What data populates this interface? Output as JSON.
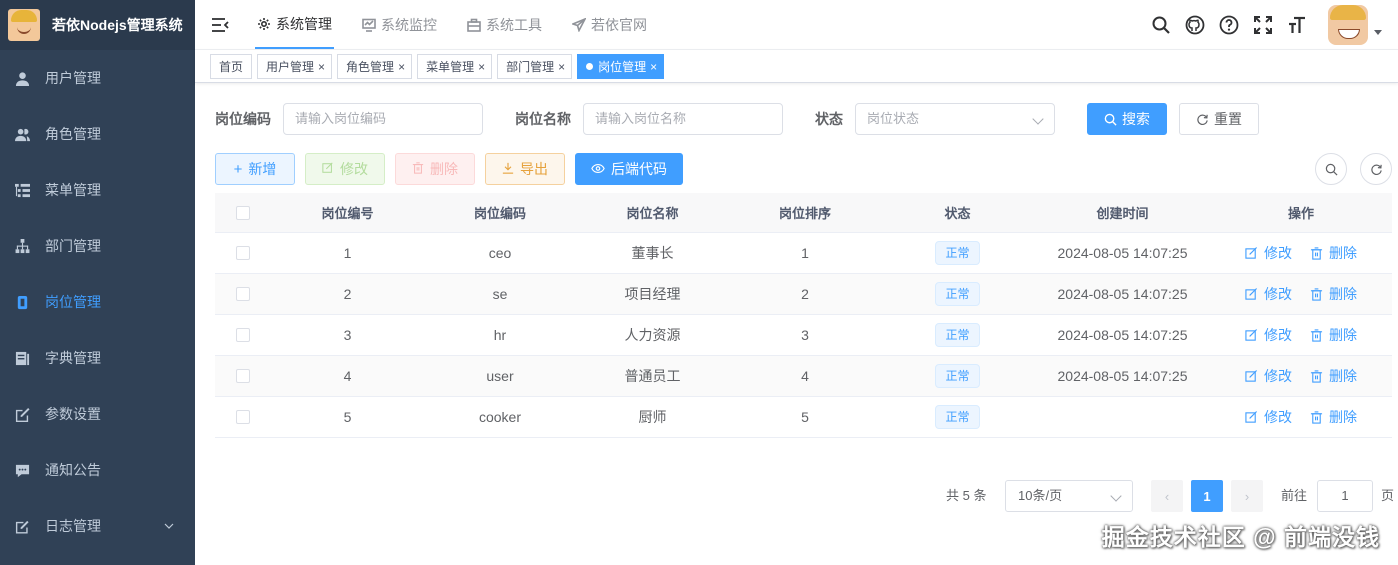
{
  "app": {
    "title": "若依Nodejs管理系统"
  },
  "sidebar": {
    "items": [
      {
        "label": "用户管理",
        "icon": "user-icon",
        "active": false
      },
      {
        "label": "角色管理",
        "icon": "peoples-icon",
        "active": false
      },
      {
        "label": "菜单管理",
        "icon": "tree-table-icon",
        "active": false
      },
      {
        "label": "部门管理",
        "icon": "tree-icon",
        "active": false
      },
      {
        "label": "岗位管理",
        "icon": "post-icon",
        "active": true
      },
      {
        "label": "字典管理",
        "icon": "dict-icon",
        "active": false
      },
      {
        "label": "参数设置",
        "icon": "edit-icon",
        "active": false
      },
      {
        "label": "通知公告",
        "icon": "message-icon",
        "active": false
      },
      {
        "label": "日志管理",
        "icon": "log-icon",
        "active": false
      }
    ]
  },
  "topnav": {
    "items": [
      {
        "label": "系统管理",
        "icon": "gear-icon"
      },
      {
        "label": "系统监控",
        "icon": "monitor-icon"
      },
      {
        "label": "系统工具",
        "icon": "toolbox-icon"
      },
      {
        "label": "若依官网",
        "icon": "send-icon"
      }
    ]
  },
  "tags": [
    {
      "label": "首页",
      "closable": false
    },
    {
      "label": "用户管理",
      "closable": true
    },
    {
      "label": "角色管理",
      "closable": true
    },
    {
      "label": "菜单管理",
      "closable": true
    },
    {
      "label": "部门管理",
      "closable": true
    },
    {
      "label": "岗位管理",
      "closable": true,
      "active": true
    }
  ],
  "search": {
    "post_code_label": "岗位编码",
    "post_code_placeholder": "请输入岗位编码",
    "post_name_label": "岗位名称",
    "post_name_placeholder": "请输入岗位名称",
    "status_label": "状态",
    "status_placeholder": "岗位状态",
    "search_button": "搜索",
    "reset_button": "重置"
  },
  "toolbar": {
    "add": "新增",
    "edit": "修改",
    "delete": "删除",
    "export": "导出",
    "code": "后端代码"
  },
  "table": {
    "columns": [
      "岗位编号",
      "岗位编码",
      "岗位名称",
      "岗位排序",
      "状态",
      "创建时间",
      "操作"
    ],
    "rows": [
      {
        "id": "1",
        "code": "ceo",
        "name": "董事长",
        "sort": "1",
        "status": "正常",
        "created": "2024-08-05 14:07:25"
      },
      {
        "id": "2",
        "code": "se",
        "name": "项目经理",
        "sort": "2",
        "status": "正常",
        "created": "2024-08-05 14:07:25"
      },
      {
        "id": "3",
        "code": "hr",
        "name": "人力资源",
        "sort": "3",
        "status": "正常",
        "created": "2024-08-05 14:07:25"
      },
      {
        "id": "4",
        "code": "user",
        "name": "普通员工",
        "sort": "4",
        "status": "正常",
        "created": "2024-08-05 14:07:25"
      },
      {
        "id": "5",
        "code": "cooker",
        "name": "厨师",
        "sort": "5",
        "status": "正常",
        "created": ""
      }
    ],
    "op_edit": "修改",
    "op_delete": "删除"
  },
  "pagination": {
    "total": "共 5 条",
    "page_size": "10条/页",
    "current_page": "1",
    "goto_label": "前往",
    "goto_value": "1",
    "page_suffix": "页"
  },
  "watermark": "掘金技术社区 @ 前端没钱",
  "colors": {
    "primary": "#409eff",
    "sidebar": "#304156"
  }
}
